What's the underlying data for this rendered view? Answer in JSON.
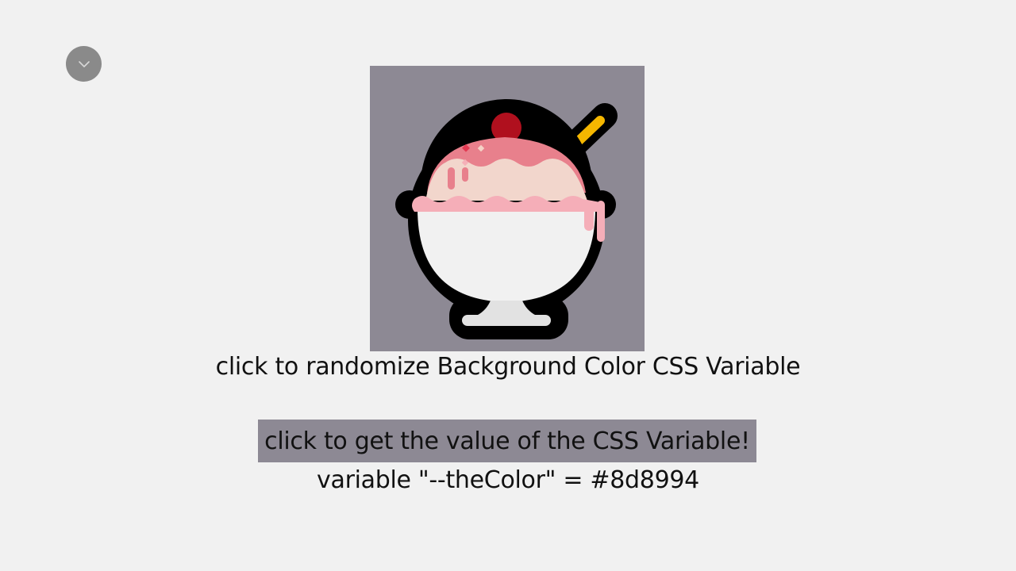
{
  "toggle": {
    "icon": "chevron-down-icon"
  },
  "image": {
    "icon": "ice-cream-sundae-icon",
    "background_color": "#8d8994"
  },
  "randomize": {
    "label": "click to randomize Background Color CSS Variable"
  },
  "get_value": {
    "label": "click to get the value of the CSS Variable!"
  },
  "result": {
    "text": "variable \"--theColor\" = #8d8994"
  }
}
